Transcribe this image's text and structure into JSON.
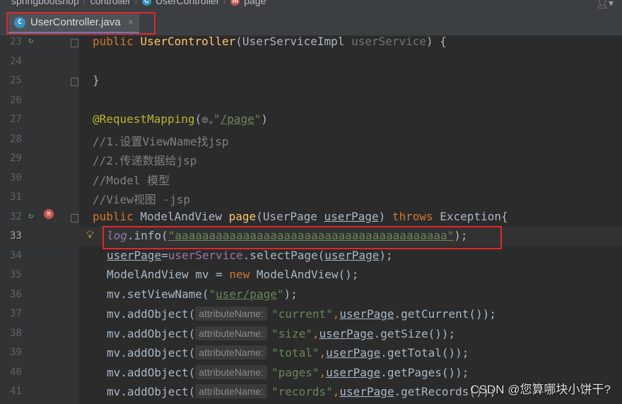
{
  "breadcrumb": {
    "items": [
      "springbootshop",
      "controller",
      "UserController",
      "page"
    ],
    "separator": "/"
  },
  "tab": {
    "filename": "UserController.java",
    "icon": "class-c-icon",
    "close": "×"
  },
  "watermark": "CSDN @您算哪块小饼干?",
  "hint_label": "attributeName:",
  "lines": {
    "l23": {
      "num": "23",
      "kw": "public",
      "name": "UserController",
      "rest1": "(UserServiceImpl ",
      "param": "userService",
      "rest2": ") {"
    },
    "l24": {
      "num": "24"
    },
    "l25": {
      "num": "25",
      "text": "}"
    },
    "l26": {
      "num": "26"
    },
    "l27": {
      "num": "27",
      "ann": "@RequestMapping",
      "open": "(",
      "glyph": "🌐︎⌄",
      "q1": "\"",
      "path": "/page",
      "q2": "\"",
      "close": ")"
    },
    "l28": {
      "num": "28",
      "text": "//1.设置ViewName找jsp"
    },
    "l29": {
      "num": "29",
      "text": "//2.传递数据给jsp"
    },
    "l30": {
      "num": "30",
      "text": "//Model 模型"
    },
    "l31": {
      "num": "31",
      "text": "//View视图 -jsp"
    },
    "l32": {
      "num": "32",
      "kw1": "public",
      "type": " ModelAndView ",
      "fn": "page",
      "p1": "(UserPage ",
      "param": "userPage",
      "p2": ") ",
      "kw2": "throws",
      "p3": " Exception{"
    },
    "l33": {
      "num": "33",
      "obj": "log",
      "mid": ".info(",
      "str": "\"aaaaaaaaaaaaaaaaaaaaaaaaaaaaaaaaaaaaaaaa\"",
      "end": ");"
    },
    "l34": {
      "num": "34",
      "a": "userPage",
      "b": "=",
      "c": "userService",
      "d": ".selectPage(",
      "e": "userPage",
      "f": ");"
    },
    "l35": {
      "num": "35",
      "a": "ModelAndView mv = ",
      "kw": "new",
      "b": " ModelAndView();"
    },
    "l36": {
      "num": "36",
      "a": "mv.setViewName(",
      "q1": "\"",
      "s": "user/page",
      "q2": "\"",
      "b": ");"
    },
    "l37": {
      "num": "37",
      "a": "mv.addObject(",
      "str": "\"current\"",
      "c": ",",
      "p": "userPage",
      "d": ".getCurrent());"
    },
    "l38": {
      "num": "38",
      "a": "mv.addObject(",
      "str": "\"size\"",
      "c": ",",
      "p": "userPage",
      "d": ".getSize());"
    },
    "l39": {
      "num": "39",
      "a": "mv.addObject(",
      "str": "\"total\"",
      "c": ",",
      "p": "userPage",
      "d": ".getTotal());"
    },
    "l40": {
      "num": "40",
      "a": "mv.addObject(",
      "str": "\"pages\"",
      "c": ",",
      "p": "userPage",
      "d": ".getPages());"
    },
    "l41": {
      "num": "41",
      "a": "mv.addObject(",
      "str": "\"records\"",
      "c": ",",
      "p": "userPage",
      "d": ".getRecords());"
    }
  }
}
